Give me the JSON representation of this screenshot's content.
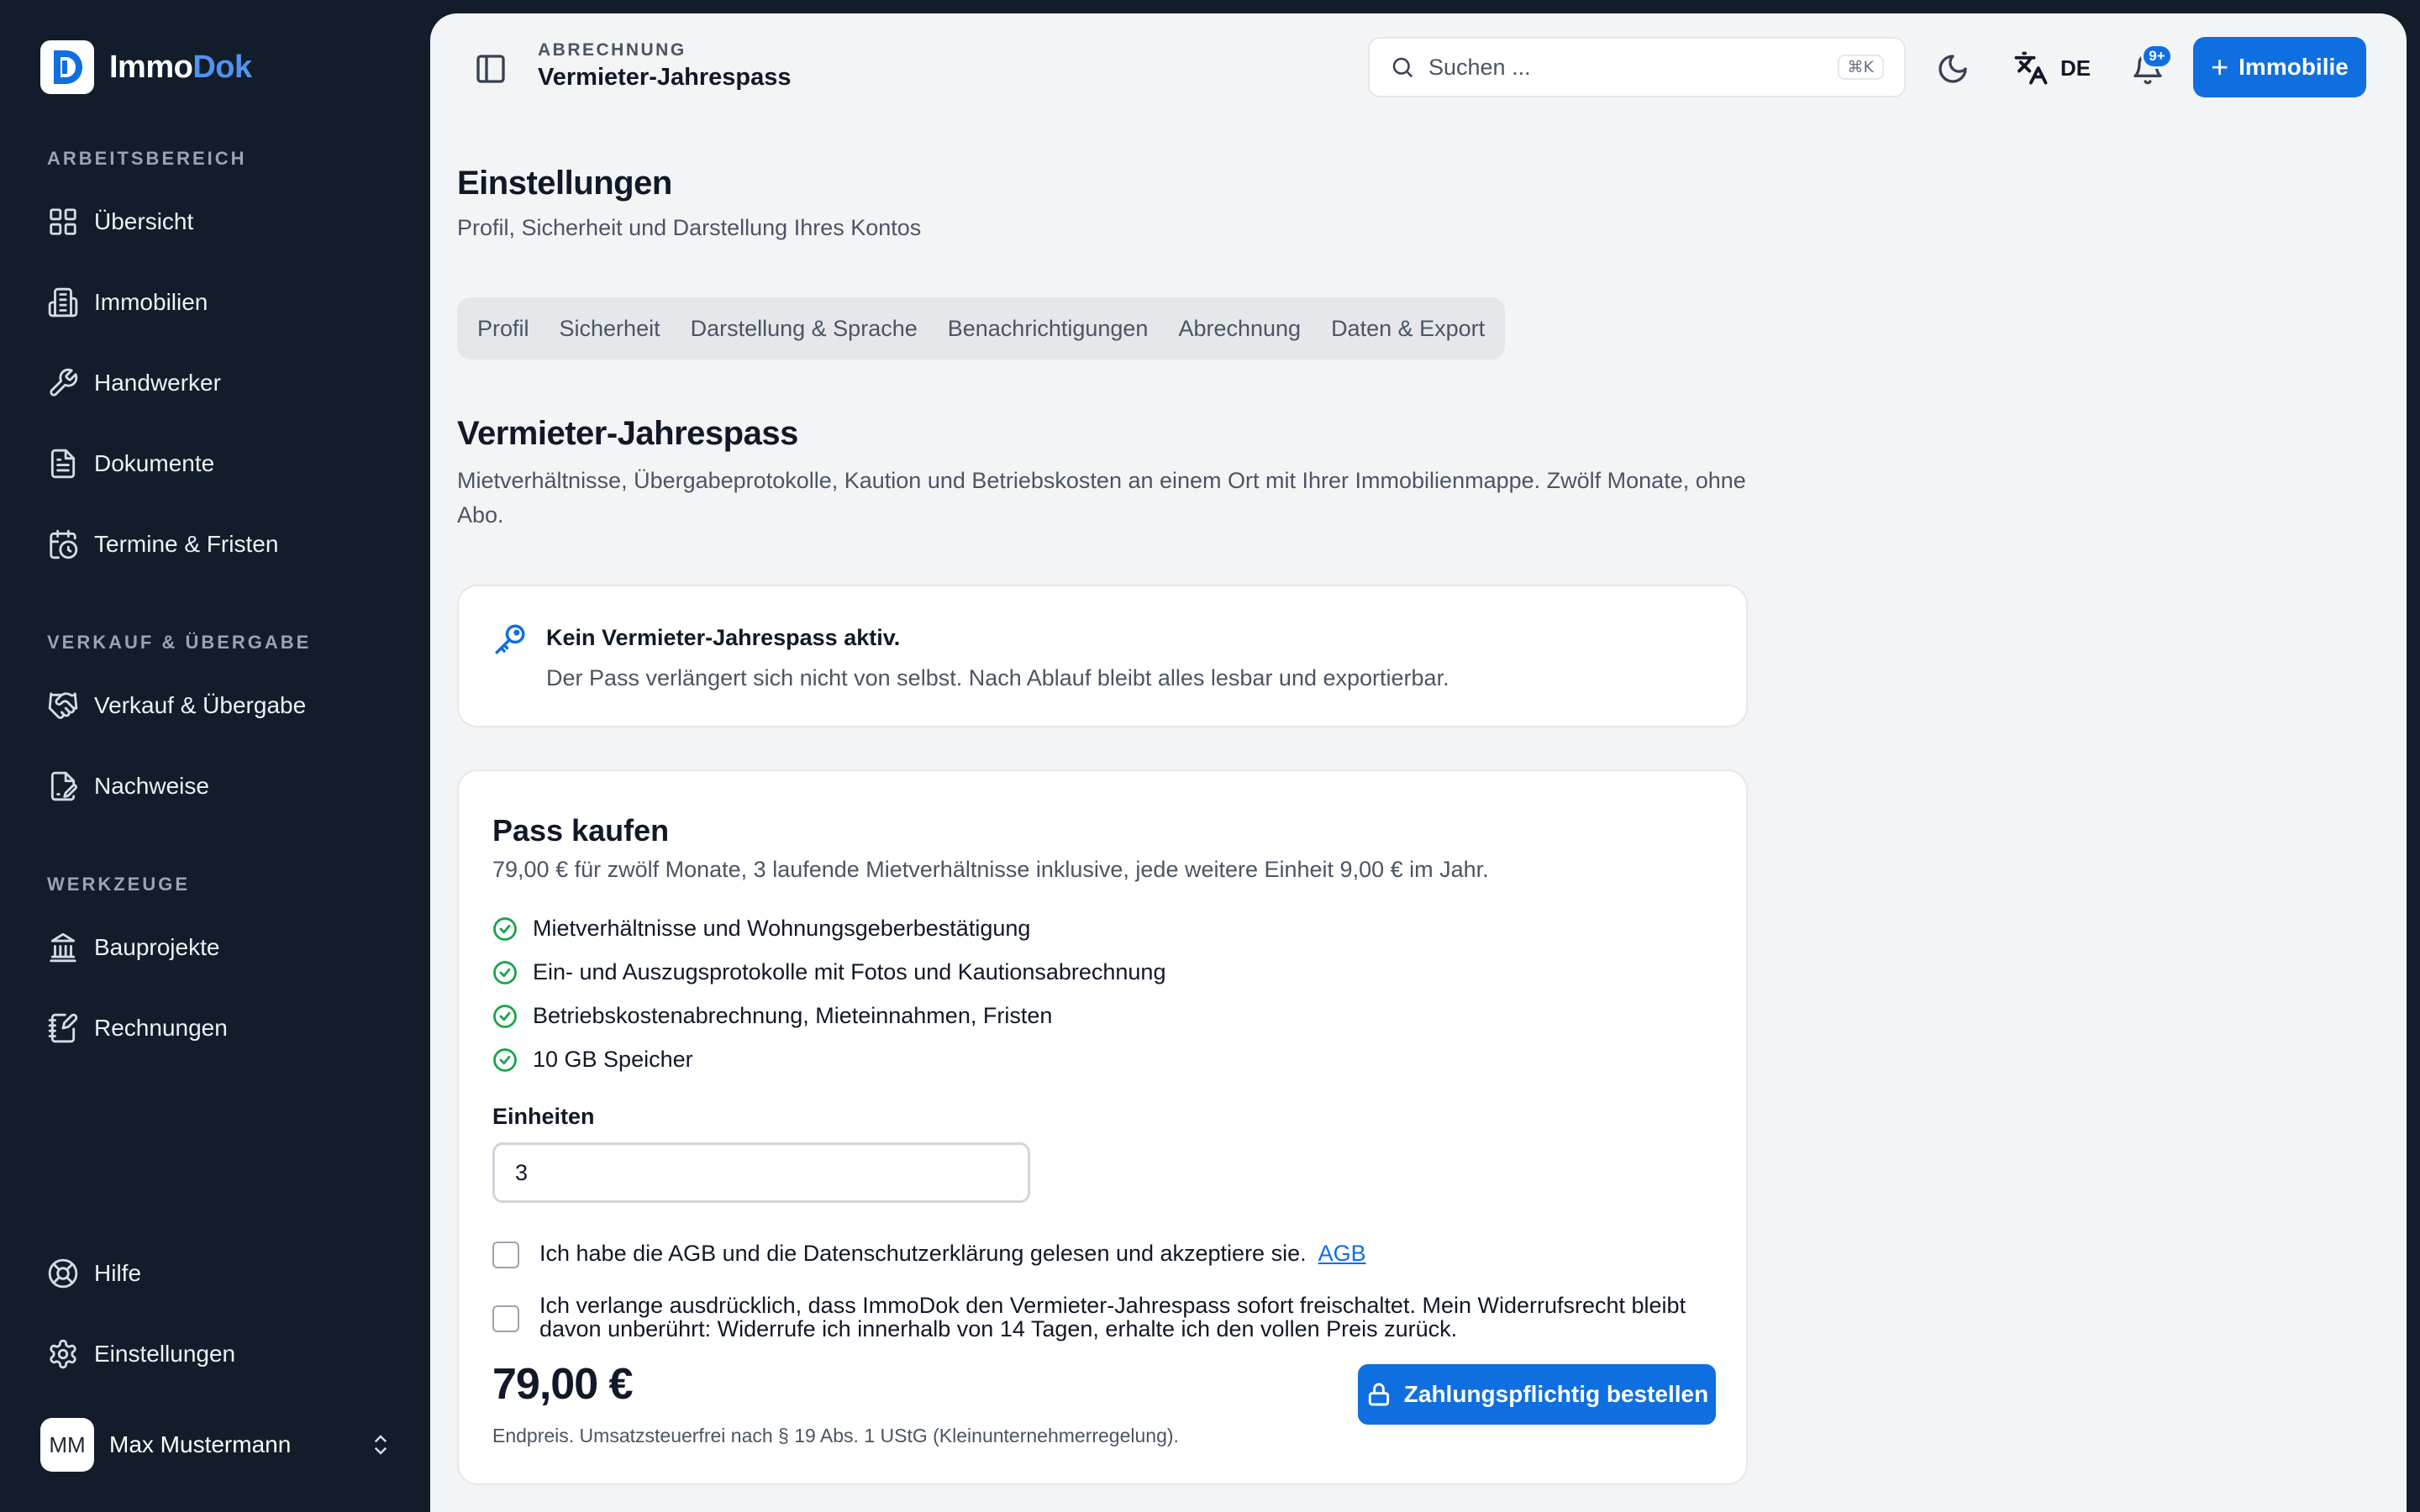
{
  "brand": {
    "name_main": "Immo",
    "name_accent": "Dok"
  },
  "sidebar": {
    "sections": [
      {
        "title": "ARBEITSBEREICH"
      },
      {
        "title": "VERKAUF & ÜBERGABE"
      },
      {
        "title": "WERKZEUGE"
      }
    ],
    "items": [
      {
        "label": "Übersicht",
        "icon": "grid-icon"
      },
      {
        "label": "Immobilien",
        "icon": "building-icon"
      },
      {
        "label": "Handwerker",
        "icon": "wrench-icon"
      },
      {
        "label": "Dokumente",
        "icon": "document-icon"
      },
      {
        "label": "Termine & Fristen",
        "icon": "calendar-clock-icon"
      },
      {
        "label": "Verkauf & Übergabe",
        "icon": "handshake-icon"
      },
      {
        "label": "Nachweise",
        "icon": "file-signature-icon"
      },
      {
        "label": "Bauprojekte",
        "icon": "landmark-icon"
      },
      {
        "label": "Rechnungen",
        "icon": "receipt-icon"
      },
      {
        "label": "Hilfe",
        "icon": "lifebuoy-icon"
      },
      {
        "label": "Einstellungen",
        "icon": "gear-icon"
      }
    ],
    "user": {
      "initials": "MM",
      "name": "Max Mustermann"
    }
  },
  "header": {
    "breadcrumb": "ABRECHNUNG",
    "title": "Vermieter-Jahrespass",
    "search": {
      "placeholder": "Suchen ...",
      "shortcut": "⌘K"
    },
    "language": "DE",
    "notifications_badge": "9+",
    "primary_button": "Immobilie"
  },
  "page": {
    "title": "Einstellungen",
    "subtitle": "Profil, Sicherheit und Darstellung Ihres Kontos",
    "tabs": [
      "Profil",
      "Sicherheit",
      "Darstellung & Sprache",
      "Benachrichtigungen",
      "Abrechnung",
      "Daten & Export"
    ],
    "selected_tab": "Abrechnung"
  },
  "section": {
    "title": "Vermieter-Jahrespass",
    "description": "Mietverhältnisse, Übergabeprotokolle, Kaution und Betriebskosten an einem Ort mit Ihrer Immobilienmappe. Zwölf Monate, ohne Abo."
  },
  "status_card": {
    "title": "Kein Vermieter-Jahrespass aktiv.",
    "text": "Der Pass verlängert sich nicht von selbst. Nach Ablauf bleibt alles lesbar und exportierbar."
  },
  "purchase": {
    "title": "Pass kaufen",
    "subtitle": "79,00 € für zwölf Monate, 3 laufende Mietverhältnisse inklusive, jede weitere Einheit 9,00 € im Jahr.",
    "features": [
      "Mietverhältnisse und Wohnungsgeberbestätigung",
      "Ein- und Auszugsprotokolle mit Fotos und Kautionsabrechnung",
      "Betriebskostenabrechnung, Mieteinnahmen, Fristen",
      "10 GB Speicher"
    ],
    "units_label": "Einheiten",
    "units_value": "3",
    "consent_terms": "Ich habe die AGB und die Datenschutzerklärung gelesen und akzeptiere sie.",
    "terms_link": "AGB",
    "consent_withdrawal": "Ich verlange ausdrücklich, dass ImmoDok den Vermieter-Jahrespass sofort freischaltet. Mein Widerrufsrecht bleibt davon unberührt: Widerrufe ich innerhalb von 14 Tagen, erhalte ich den vollen Preis zurück.",
    "price": "79,00 €",
    "price_note": "Endpreis. Umsatzsteuerfrei nach § 19 Abs. 1 UStG (Kleinunternehmerregelung).",
    "buy_button": "Zahlungspflichtig bestellen"
  },
  "colors": {
    "accent": "#0f6fe0",
    "sidebar_bg": "#131c2a",
    "success": "#16a34a"
  }
}
